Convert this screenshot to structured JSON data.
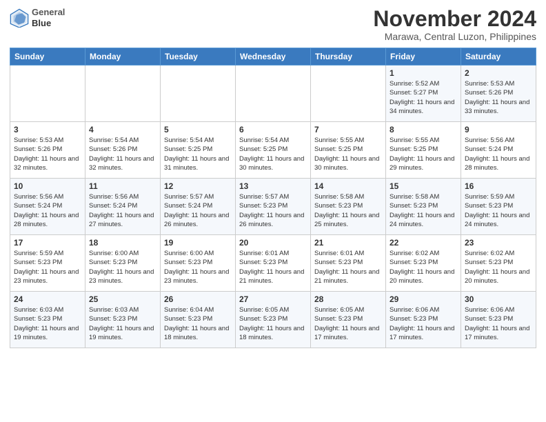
{
  "header": {
    "logo_line1": "General",
    "logo_line2": "Blue",
    "month": "November 2024",
    "location": "Marawa, Central Luzon, Philippines"
  },
  "days_of_week": [
    "Sunday",
    "Monday",
    "Tuesday",
    "Wednesday",
    "Thursday",
    "Friday",
    "Saturday"
  ],
  "weeks": [
    [
      {
        "day": "",
        "info": ""
      },
      {
        "day": "",
        "info": ""
      },
      {
        "day": "",
        "info": ""
      },
      {
        "day": "",
        "info": ""
      },
      {
        "day": "",
        "info": ""
      },
      {
        "day": "1",
        "info": "Sunrise: 5:52 AM\nSunset: 5:27 PM\nDaylight: 11 hours\nand 34 minutes."
      },
      {
        "day": "2",
        "info": "Sunrise: 5:53 AM\nSunset: 5:26 PM\nDaylight: 11 hours\nand 33 minutes."
      }
    ],
    [
      {
        "day": "3",
        "info": "Sunrise: 5:53 AM\nSunset: 5:26 PM\nDaylight: 11 hours\nand 32 minutes."
      },
      {
        "day": "4",
        "info": "Sunrise: 5:54 AM\nSunset: 5:26 PM\nDaylight: 11 hours\nand 32 minutes."
      },
      {
        "day": "5",
        "info": "Sunrise: 5:54 AM\nSunset: 5:25 PM\nDaylight: 11 hours\nand 31 minutes."
      },
      {
        "day": "6",
        "info": "Sunrise: 5:54 AM\nSunset: 5:25 PM\nDaylight: 11 hours\nand 30 minutes."
      },
      {
        "day": "7",
        "info": "Sunrise: 5:55 AM\nSunset: 5:25 PM\nDaylight: 11 hours\nand 30 minutes."
      },
      {
        "day": "8",
        "info": "Sunrise: 5:55 AM\nSunset: 5:25 PM\nDaylight: 11 hours\nand 29 minutes."
      },
      {
        "day": "9",
        "info": "Sunrise: 5:56 AM\nSunset: 5:24 PM\nDaylight: 11 hours\nand 28 minutes."
      }
    ],
    [
      {
        "day": "10",
        "info": "Sunrise: 5:56 AM\nSunset: 5:24 PM\nDaylight: 11 hours\nand 28 minutes."
      },
      {
        "day": "11",
        "info": "Sunrise: 5:56 AM\nSunset: 5:24 PM\nDaylight: 11 hours\nand 27 minutes."
      },
      {
        "day": "12",
        "info": "Sunrise: 5:57 AM\nSunset: 5:24 PM\nDaylight: 11 hours\nand 26 minutes."
      },
      {
        "day": "13",
        "info": "Sunrise: 5:57 AM\nSunset: 5:23 PM\nDaylight: 11 hours\nand 26 minutes."
      },
      {
        "day": "14",
        "info": "Sunrise: 5:58 AM\nSunset: 5:23 PM\nDaylight: 11 hours\nand 25 minutes."
      },
      {
        "day": "15",
        "info": "Sunrise: 5:58 AM\nSunset: 5:23 PM\nDaylight: 11 hours\nand 24 minutes."
      },
      {
        "day": "16",
        "info": "Sunrise: 5:59 AM\nSunset: 5:23 PM\nDaylight: 11 hours\nand 24 minutes."
      }
    ],
    [
      {
        "day": "17",
        "info": "Sunrise: 5:59 AM\nSunset: 5:23 PM\nDaylight: 11 hours\nand 23 minutes."
      },
      {
        "day": "18",
        "info": "Sunrise: 6:00 AM\nSunset: 5:23 PM\nDaylight: 11 hours\nand 23 minutes."
      },
      {
        "day": "19",
        "info": "Sunrise: 6:00 AM\nSunset: 5:23 PM\nDaylight: 11 hours\nand 23 minutes."
      },
      {
        "day": "20",
        "info": "Sunrise: 6:01 AM\nSunset: 5:23 PM\nDaylight: 11 hours\nand 21 minutes."
      },
      {
        "day": "21",
        "info": "Sunrise: 6:01 AM\nSunset: 5:23 PM\nDaylight: 11 hours\nand 21 minutes."
      },
      {
        "day": "22",
        "info": "Sunrise: 6:02 AM\nSunset: 5:23 PM\nDaylight: 11 hours\nand 20 minutes."
      },
      {
        "day": "23",
        "info": "Sunrise: 6:02 AM\nSunset: 5:23 PM\nDaylight: 11 hours\nand 20 minutes."
      }
    ],
    [
      {
        "day": "24",
        "info": "Sunrise: 6:03 AM\nSunset: 5:23 PM\nDaylight: 11 hours\nand 19 minutes."
      },
      {
        "day": "25",
        "info": "Sunrise: 6:03 AM\nSunset: 5:23 PM\nDaylight: 11 hours\nand 19 minutes."
      },
      {
        "day": "26",
        "info": "Sunrise: 6:04 AM\nSunset: 5:23 PM\nDaylight: 11 hours\nand 18 minutes."
      },
      {
        "day": "27",
        "info": "Sunrise: 6:05 AM\nSunset: 5:23 PM\nDaylight: 11 hours\nand 18 minutes."
      },
      {
        "day": "28",
        "info": "Sunrise: 6:05 AM\nSunset: 5:23 PM\nDaylight: 11 hours\nand 17 minutes."
      },
      {
        "day": "29",
        "info": "Sunrise: 6:06 AM\nSunset: 5:23 PM\nDaylight: 11 hours\nand 17 minutes."
      },
      {
        "day": "30",
        "info": "Sunrise: 6:06 AM\nSunset: 5:23 PM\nDaylight: 11 hours\nand 17 minutes."
      }
    ]
  ]
}
